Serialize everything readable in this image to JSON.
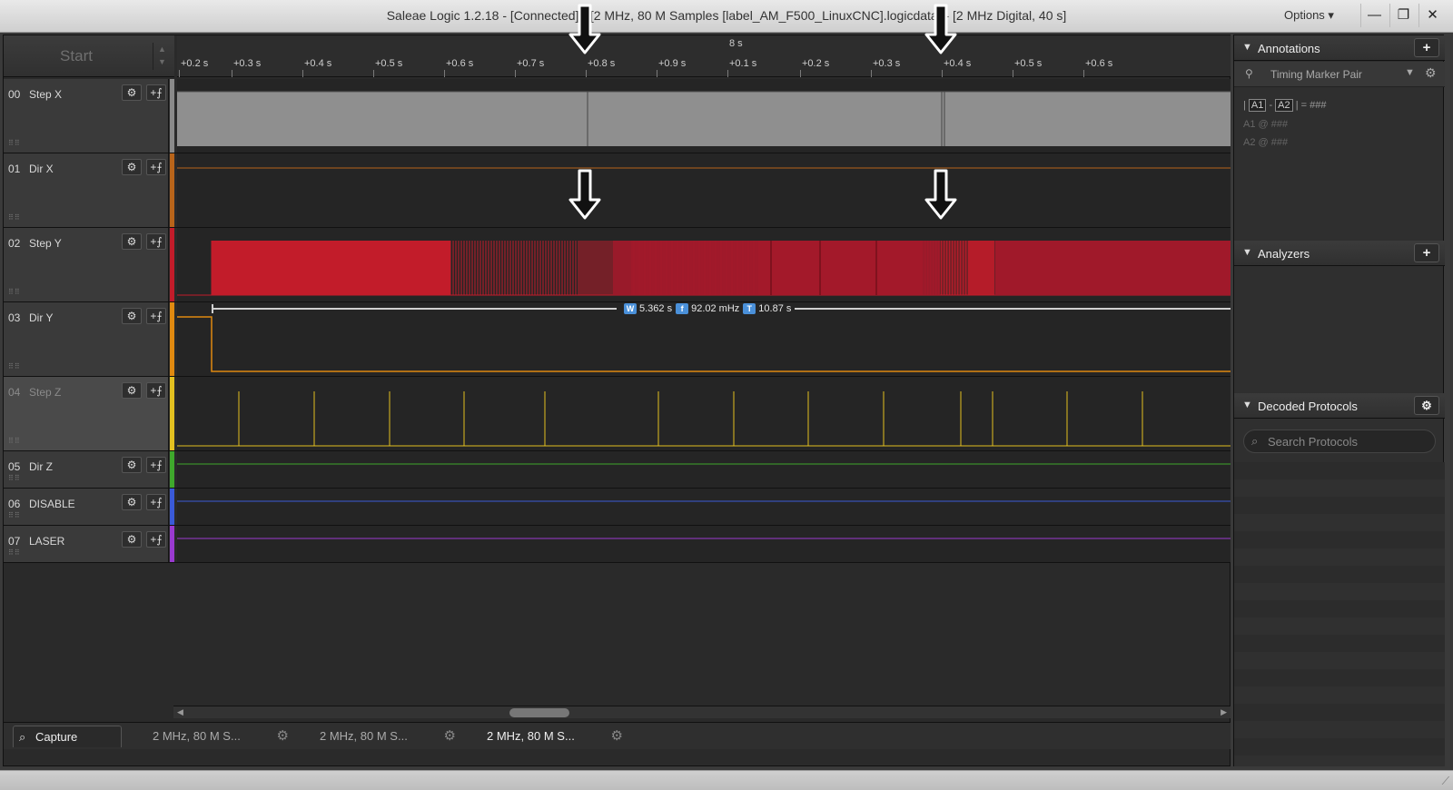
{
  "window": {
    "title": "Saleae Logic 1.2.18 - [Connected] - [2 MHz, 80 M Samples [label_AM_F500_LinuxCNC].logicdata] - [2 MHz Digital, 40 s]",
    "options_label": "Options ▾",
    "minimize": "—",
    "restore": "❐",
    "close": "✕"
  },
  "toolbar": {
    "start_label": "Start"
  },
  "ruler": {
    "center_label": "8 s",
    "ticks": [
      "+0.2 s",
      "+0.3 s",
      "+0.4 s",
      "+0.5 s",
      "+0.6 s",
      "+0.7 s",
      "+0.8 s",
      "+0.9 s",
      "+0.1 s",
      "+0.2 s",
      "+0.3 s",
      "+0.4 s",
      "+0.5 s",
      "+0.6 s"
    ]
  },
  "channels": [
    {
      "num": "00",
      "name": "Step X",
      "color": "#8a8a8a"
    },
    {
      "num": "01",
      "name": "Dir X",
      "color": "#b8641a"
    },
    {
      "num": "02",
      "name": "Step Y",
      "color": "#c21c2a"
    },
    {
      "num": "03",
      "name": "Dir Y",
      "color": "#e08a10"
    },
    {
      "num": "04",
      "name": "Step Z",
      "color": "#e3c020"
    },
    {
      "num": "05",
      "name": "Dir Z",
      "color": "#3fa82c"
    },
    {
      "num": "06",
      "name": "DISABLE",
      "color": "#3a5ad8"
    },
    {
      "num": "07",
      "name": "LASER",
      "color": "#9a3ad0"
    }
  ],
  "measurement": {
    "width_badge": "W",
    "width": "5.362 s",
    "freq_badge": "f",
    "freq": "92.02 mHz",
    "period_badge": "T",
    "period": "10.87 s"
  },
  "tabs": {
    "capture": "Capture",
    "sessions": [
      "2 MHz, 80 M S...",
      "2 MHz, 80 M S...",
      "2 MHz, 80 M S..."
    ]
  },
  "annotations": {
    "title": "Annotations",
    "marker_pair": "Timing Marker Pair",
    "a1": "A1",
    "a2": "A2",
    "diff_value": "= ###",
    "a1_line": "A1  @  ###",
    "a2_line": "A2  @  ###"
  },
  "analyzers": {
    "title": "Analyzers"
  },
  "decoded_protocols": {
    "title": "Decoded Protocols",
    "search_placeholder": "Search Protocols"
  }
}
